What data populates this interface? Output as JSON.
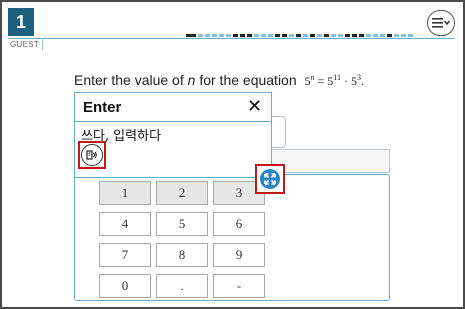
{
  "header": {
    "question_number": "1",
    "user_label": "GUEST",
    "menu_icon": "menu-dropdown-icon"
  },
  "question": {
    "prompt_before": "Enter the value of ",
    "prompt_var": "n",
    "prompt_after": " for the equation ",
    "eq_base1": "5",
    "eq_exp1": "n",
    "eq_eq": " = ",
    "eq_base2": "5",
    "eq_exp2": "11",
    "eq_dot": " · ",
    "eq_base3": "5",
    "eq_exp3": "3",
    "eq_end": "."
  },
  "glossary_popup": {
    "title": "Enter",
    "close_label": "✕",
    "translation": "쓰다, 입력하다",
    "audio_icon": "audio-speaker-icon"
  },
  "expand_icon": "expand-arrows-icon",
  "keypad": {
    "rows": [
      [
        "1",
        "2",
        "3"
      ],
      [
        "4",
        "5",
        "6"
      ],
      [
        "7",
        "8",
        "9"
      ],
      [
        "0",
        ".",
        "-"
      ]
    ]
  },
  "colors": {
    "question_badge": "#1f5f80",
    "highlight_border": "#c0181b",
    "accent": "#2f86c4"
  }
}
